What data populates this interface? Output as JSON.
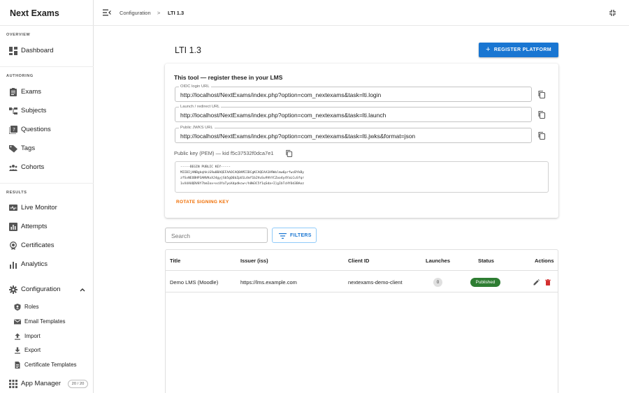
{
  "app": {
    "title": "Next Exams"
  },
  "sidebar": {
    "sections": [
      "OVERVIEW",
      "AUTHORING",
      "RESULTS"
    ],
    "overview": [
      {
        "label": "Dashboard",
        "icon": "dashboard-icon"
      }
    ],
    "authoring": [
      {
        "label": "Exams",
        "icon": "clipboard-icon"
      },
      {
        "label": "Subjects",
        "icon": "hierarchy-icon"
      },
      {
        "label": "Questions",
        "icon": "quiz-icon"
      },
      {
        "label": "Tags",
        "icon": "tag-icon"
      },
      {
        "label": "Cohorts",
        "icon": "group-icon"
      }
    ],
    "results": [
      {
        "label": "Live Monitor",
        "icon": "monitor-icon"
      },
      {
        "label": "Attempts",
        "icon": "bar-report-icon"
      },
      {
        "label": "Certificates",
        "icon": "badge-icon"
      },
      {
        "label": "Analytics",
        "icon": "chart-icon"
      }
    ],
    "configuration": {
      "label": "Configuration",
      "icon": "gear-icon",
      "expanded": true,
      "children": [
        {
          "label": "Roles",
          "icon": "shield-icon"
        },
        {
          "label": "Email Templates",
          "icon": "mail-icon"
        },
        {
          "label": "Import",
          "icon": "upload-icon"
        },
        {
          "label": "Export",
          "icon": "download-icon"
        },
        {
          "label": "Certificate Templates",
          "icon": "document-icon"
        }
      ]
    },
    "app_manager": {
      "label": "App Manager",
      "badge": "20 / 20",
      "icon": "grid-icon"
    }
  },
  "topbar": {
    "breadcrumb": [
      "Configuration",
      "LTI 1.3"
    ],
    "separator": ">"
  },
  "page": {
    "title": "LTI 1.3",
    "register_button": "REGISTER PLATFORM",
    "tool_card": {
      "title": "This tool — register these in your LMS",
      "fields": [
        {
          "label": "OIDC login URL",
          "value": "http://localhost/NextExams/index.php?option=com_nextexams&task=lti.login"
        },
        {
          "label": "Launch / redirect URL",
          "value": "http://localhost/NextExams/index.php?option=com_nextexams&task=lti.launch"
        },
        {
          "label": "Public JWKS URL",
          "value": "http://localhost/NextExams/index.php?option=com_nextexams&task=lti.jwks&format=json"
        }
      ],
      "pem_label": "Public key (PEM) — kid f5c37532f0dca7e1",
      "pem_lines": [
        "-----BEGIN PUBLIC KEY-----",
        "MIIBIjANBgkqhkiG9w0BAQEFAAOCAQ8AMIIBCgKCAQEAA1H9Wolmw6prfwcBYkBy",
        "zfSvNEOBHP3ANVKxXJ4gyjSb5gQ6bZpU1L4mf1b2VuSu9VhYCZoo4y4YaLCuSfqr",
        "1vX4AUQDV8Y7bmIox+xcUYaTyoXdpdkcw+/h0W3C5f1qSda+I]gIbTcHYOd3BAoz"
      ],
      "rotate_label": "ROTATE SIGNING KEY"
    },
    "search_placeholder": "Search",
    "filters_label": "FILTERS",
    "table": {
      "columns": [
        "Title",
        "Issuer (iss)",
        "Client ID",
        "Launches",
        "Status",
        "Actions"
      ],
      "rows": [
        {
          "title": "Demo LMS (Moodle)",
          "issuer": "https://lms.example.com",
          "client_id": "nextexams-demo-client",
          "launches": "0",
          "status": "Published"
        }
      ]
    }
  },
  "colors": {
    "primary": "#1976d2",
    "accent_orange": "#ef6c00",
    "published": "#2e7d32",
    "delete": "#d32f2f"
  }
}
